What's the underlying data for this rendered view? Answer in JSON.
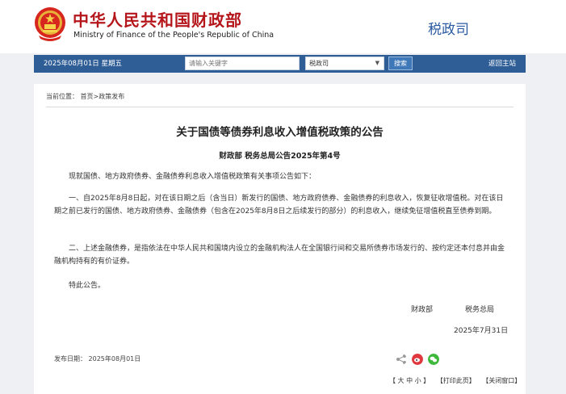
{
  "header": {
    "site_title_cn": "中华人民共和国财政部",
    "site_title_en": "Ministry of Finance of the People's Republic of China",
    "department": "税政司"
  },
  "navbar": {
    "date": "2025年08月01日  星期五",
    "search_placeholder": "请输入关键字",
    "select_value": "税政司",
    "search_button": "搜索",
    "home_link": "返回主站"
  },
  "article": {
    "breadcrumb": "当前位置：  首页>政策发布",
    "title": "关于国债等债券利息收入增值税政策的公告",
    "doc_number": "财政部  税务总局公告2025年第4号",
    "paragraphs": [
      "现就国债、地方政府债券、金融债券利息收入增值税政策有关事项公告如下：",
      "一、自2025年8月8日起，对在该日期之后（含当日）新发行的国债、地方政府债券、金融债券的利息收入，恢复征收增值税。对在该日期之前已发行的国债、地方政府债券、金融债券（包含在2025年8月8日之后续发行的部分）的利息收入，继续免征增值税直至债券到期。",
      "二、上述金融债券，是指依法在中华人民共和国境内设立的金融机构法人在全国银行间和交易所债券市场发行的、按约定还本付息并由金融机构持有的有价证券。",
      "特此公告。"
    ],
    "signer_1": "财政部",
    "signer_2": "税务总局",
    "sign_date": "2025年7月31日",
    "publish_date": "发布日期：  2025年08月01日"
  },
  "footer": {
    "font_size": "【 大 中 小 】",
    "print": "【打印此页】",
    "close": "【关闭窗口】"
  },
  "icons": {
    "share": "share-icon",
    "weibo": "weibo-icon",
    "wechat": "wechat-icon"
  },
  "colors": {
    "brand_red": "#b5161b",
    "navbar_blue": "#2f5e97",
    "department_blue": "#2a5aa0",
    "weibo_red": "#e0383e",
    "wechat_green": "#3db83a"
  }
}
